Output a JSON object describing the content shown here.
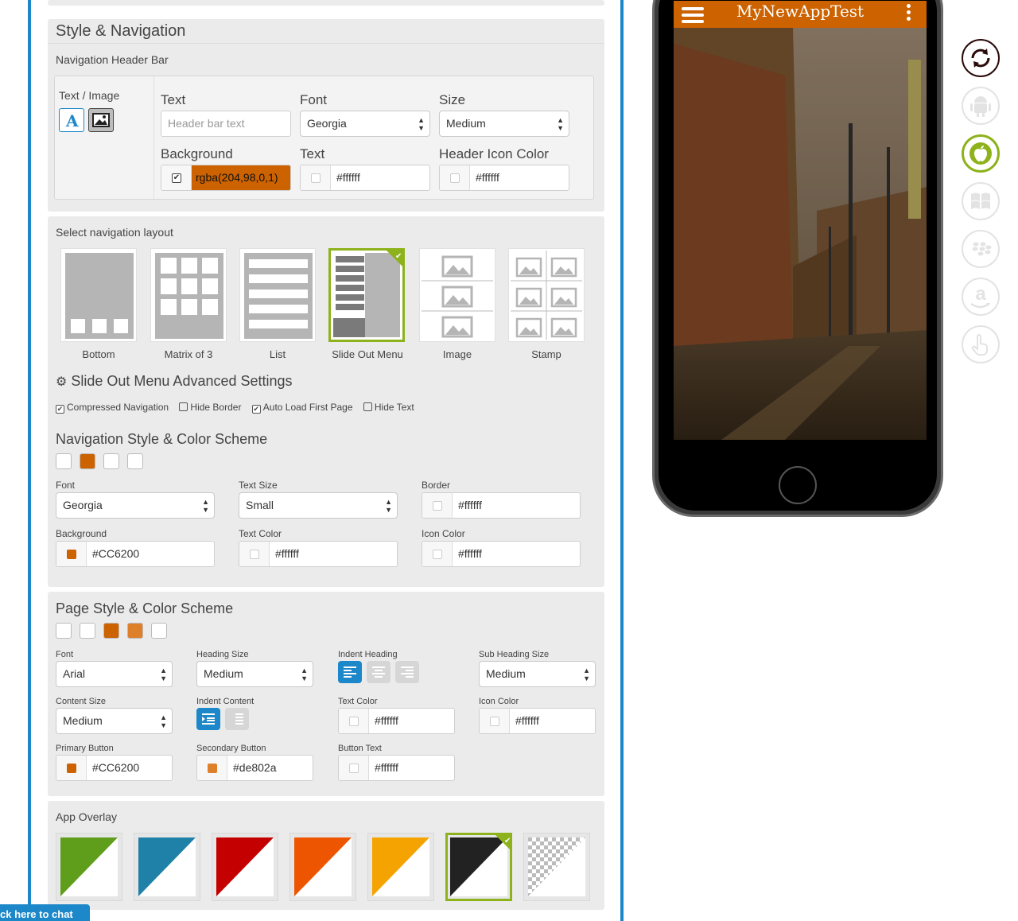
{
  "style_nav": {
    "title": "Style & Navigation",
    "header_bar_title": "Navigation Header Bar",
    "text_image_label": "Text / Image",
    "text_label": "Text",
    "text_placeholder": "Header bar text",
    "font_label": "Font",
    "font_value": "Georgia",
    "size_label": "Size",
    "size_value": "Medium",
    "background_label": "Background",
    "background_value": "rgba(204,98,0,1)",
    "text_color_label": "Text",
    "text_color_value": "#ffffff",
    "header_icon_label": "Header Icon Color",
    "header_icon_value": "#ffffff"
  },
  "layout": {
    "title": "Select navigation layout",
    "options": [
      "Bottom",
      "Matrix of 3",
      "List",
      "Slide Out Menu",
      "Image",
      "Stamp"
    ],
    "selected": "Slide Out Menu",
    "advanced_title": "Slide Out Menu Advanced Settings",
    "checkboxes": [
      {
        "label": "Compressed Navigation",
        "checked": true
      },
      {
        "label": "Hide Border",
        "checked": false
      },
      {
        "label": "Auto Load First Page",
        "checked": true
      },
      {
        "label": "Hide Text",
        "checked": false
      }
    ]
  },
  "nav_style": {
    "title": "Navigation Style & Color Scheme",
    "font_label": "Font",
    "font_value": "Georgia",
    "text_size_label": "Text Size",
    "text_size_value": "Small",
    "border_label": "Border",
    "border_value": "#ffffff",
    "background_label": "Background",
    "background_value": "#CC6200",
    "text_color_label": "Text Color",
    "text_color_value": "#ffffff",
    "icon_color_label": "Icon Color",
    "icon_color_value": "#ffffff"
  },
  "page_style": {
    "title": "Page Style & Color Scheme",
    "font_label": "Font",
    "font_value": "Arial",
    "heading_size_label": "Heading Size",
    "heading_size_value": "Medium",
    "indent_heading_label": "Indent Heading",
    "sub_heading_label": "Sub Heading Size",
    "sub_heading_value": "Medium",
    "content_size_label": "Content Size",
    "content_size_value": "Medium",
    "indent_content_label": "Indent Content",
    "text_color_label": "Text Color",
    "text_color_value": "#ffffff",
    "icon_color_label": "Icon Color",
    "icon_color_value": "#ffffff",
    "primary_label": "Primary Button",
    "primary_value": "#CC6200",
    "secondary_label": "Secondary Button",
    "secondary_value": "#de802a",
    "button_text_label": "Button Text",
    "button_text_value": "#ffffff"
  },
  "overlay": {
    "title": "App Overlay",
    "colors": [
      "#5e9e1a",
      "#1f80a8",
      "#c40000",
      "#ee5500",
      "#f4a300",
      "#222222",
      "checker"
    ],
    "selected_index": 5
  },
  "phone": {
    "app_title": "MyNewAppTest",
    "header_color": "#CC6200"
  },
  "platform_icons": [
    "refresh-icon",
    "android-icon",
    "apple-icon",
    "windows-icon",
    "blackberry-icon",
    "amazon-icon",
    "touch-icon"
  ],
  "chat": {
    "label": "ck here to chat"
  },
  "colors": {
    "accent": "#1c87c9",
    "brand_orange": "#CC6200",
    "selected_green": "#8db21b"
  }
}
